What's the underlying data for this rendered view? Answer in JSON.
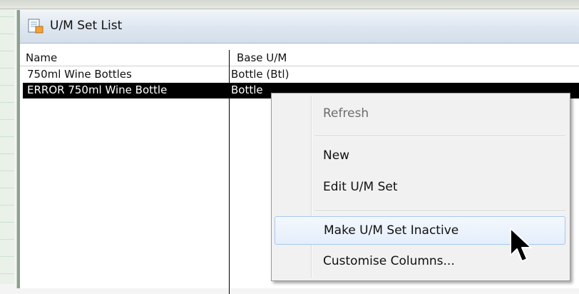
{
  "window": {
    "title": "U/M Set List",
    "icon": "document-icon"
  },
  "table": {
    "columns": [
      "Name",
      "Base U/M"
    ],
    "rows": [
      {
        "name": "750ml Wine Bottles",
        "base": "Bottle (Btl)",
        "selected": false
      },
      {
        "name": "ERROR 750ml Wine Bottle",
        "base": "Bottle",
        "selected": true
      }
    ]
  },
  "context_menu": {
    "items": [
      {
        "label": "Refresh",
        "enabled": false
      },
      {
        "label": "New",
        "enabled": true
      },
      {
        "label": "Edit U/M Set",
        "enabled": true
      },
      {
        "label": "Make U/M Set Inactive",
        "enabled": true,
        "hovered": true
      },
      {
        "label": "Customise Columns...",
        "enabled": true
      }
    ]
  },
  "colors": {
    "selection": "#000000",
    "hover_border": "#a8c8ec",
    "titlebar": "#dde6f0"
  }
}
